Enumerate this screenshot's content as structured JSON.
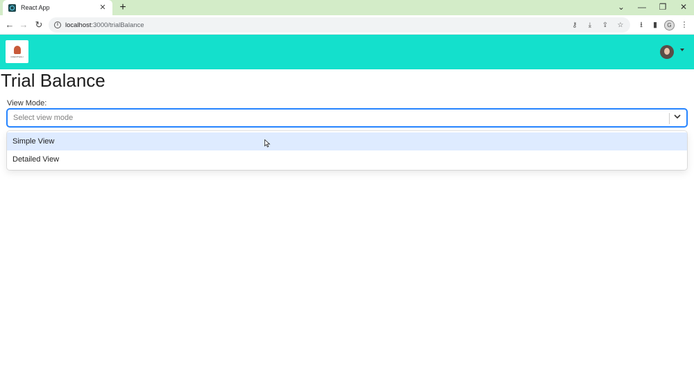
{
  "browser": {
    "tab_title": "React App",
    "tab_close": "✕",
    "new_tab": "+",
    "url_host": "localhost",
    "url_rest": ":3000/trialBalance",
    "profile_initial": "G",
    "controls": {
      "chevron": "⌄",
      "minimize": "—",
      "restore": "❐",
      "close": "✕"
    }
  },
  "app": {
    "logo_text": "CREDITWALI"
  },
  "page": {
    "title": "Trial Balance",
    "view_mode_label": "View Mode:",
    "select_placeholder": "Select view mode",
    "options": [
      {
        "label": "Simple View",
        "focused": true
      },
      {
        "label": "Detailed View",
        "focused": false
      }
    ]
  },
  "colors": {
    "header_bg": "#14e0cc",
    "tabstrip_bg": "#d3ecc8",
    "select_focus": "#2684ff",
    "option_focus_bg": "#deebff"
  }
}
